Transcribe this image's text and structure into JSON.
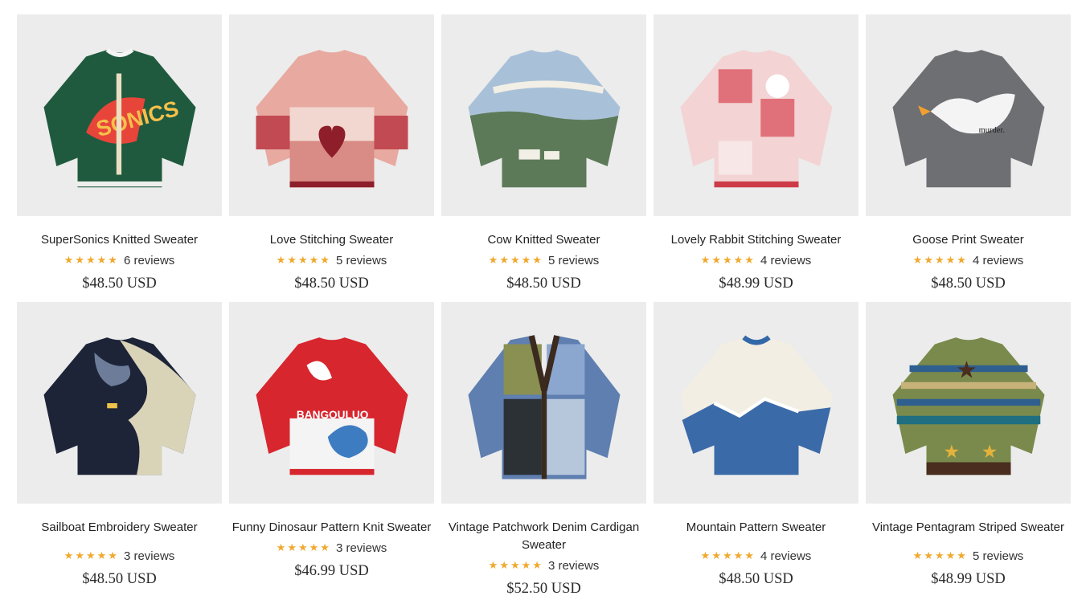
{
  "products": [
    {
      "title": "SuperSonics Knitted Sweater",
      "stars": "★★★★★",
      "reviews": "6 reviews",
      "price": "$48.50 USD",
      "image_icon": "green-sonics-sweater"
    },
    {
      "title": "Love Stitching Sweater",
      "stars": "★★★★★",
      "reviews": "5 reviews",
      "price": "$48.50 USD",
      "image_icon": "pink-heart-sweater"
    },
    {
      "title": "Cow Knitted Sweater",
      "stars": "★★★★★",
      "reviews": "5 reviews",
      "price": "$48.50 USD",
      "image_icon": "cow-landscape-sweater"
    },
    {
      "title": "Lovely Rabbit Stitching Sweater",
      "stars": "★★★★★",
      "reviews": "4 reviews",
      "price": "$48.99 USD",
      "image_icon": "pink-rabbit-sweater"
    },
    {
      "title": "Goose Print Sweater",
      "stars": "★★★★★",
      "reviews": "4 reviews",
      "price": "$48.50 USD",
      "image_icon": "grey-goose-sweater"
    },
    {
      "title": "Sailboat Embroidery Sweater",
      "stars": "★★★★★",
      "reviews": "3 reviews",
      "price": "$48.50 USD",
      "image_icon": "sailboat-camo-sweater"
    },
    {
      "title": "Funny Dinosaur Pattern Knit Sweater",
      "stars": "★★★★★",
      "reviews": "3 reviews",
      "price": "$46.99 USD",
      "image_icon": "red-dinosaur-sweater"
    },
    {
      "title": "Vintage Patchwork Denim Cardigan Sweater",
      "stars": "★★★★★",
      "reviews": "3 reviews",
      "price": "$52.50 USD",
      "image_icon": "denim-patchwork-cardigan"
    },
    {
      "title": "Mountain Pattern Sweater",
      "stars": "★★★★★",
      "reviews": "4 reviews",
      "price": "$48.50 USD",
      "image_icon": "mountain-sweater"
    },
    {
      "title": "Vintage Pentagram Striped Sweater",
      "stars": "★★★★★",
      "reviews": "5 reviews",
      "price": "$48.99 USD",
      "image_icon": "striped-star-sweater"
    }
  ],
  "colors": {
    "star": "#f0a92e",
    "image_bg": "#ececec"
  }
}
